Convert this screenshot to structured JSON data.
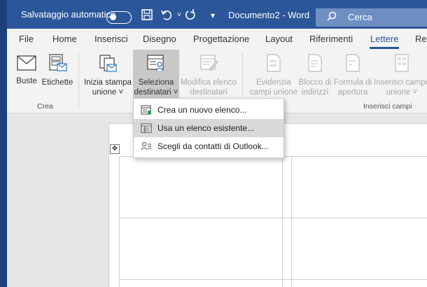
{
  "titlebar": {
    "autosave_label": "Salvataggio automatico",
    "document_title": "Documento2  -  Word",
    "search_placeholder": "Cerca"
  },
  "tabs": [
    {
      "label": "File"
    },
    {
      "label": "Home"
    },
    {
      "label": "Inserisci"
    },
    {
      "label": "Disegno"
    },
    {
      "label": "Progettazione"
    },
    {
      "label": "Layout"
    },
    {
      "label": "Riferimenti"
    },
    {
      "label": "Lettere",
      "active": true
    },
    {
      "label": "Rev"
    }
  ],
  "ribbon": {
    "buste": "Buste",
    "etichette": "Etichette",
    "group_crea": "Crea",
    "inizia_stampa": [
      "Inizia stampa",
      "unione ˅"
    ],
    "seleziona_destinatari": [
      "Seleziona",
      "destinatari ˅"
    ],
    "modifica_elenco": [
      "Modifica elenco",
      "destinatari"
    ],
    "evidenzia": [
      "Evidenzia",
      "campi unione"
    ],
    "blocco": [
      "Blocco di",
      "indirizzi"
    ],
    "formula": [
      "Formula di",
      "apertura"
    ],
    "inserisci_campo": [
      "Inserisci campo",
      "unione ˅"
    ],
    "group_inserisci_campi": "Inserisci campi",
    "group_avvia_partial": "I"
  },
  "dropdown": {
    "items": [
      {
        "label": "Crea un nuovo elenco...",
        "icon": "new-list-icon"
      },
      {
        "label": "Usa un elenco esistente...",
        "icon": "existing-list-icon"
      },
      {
        "label": "Scegli da contatti di Outlook...",
        "icon": "outlook-contacts-icon"
      }
    ]
  }
}
